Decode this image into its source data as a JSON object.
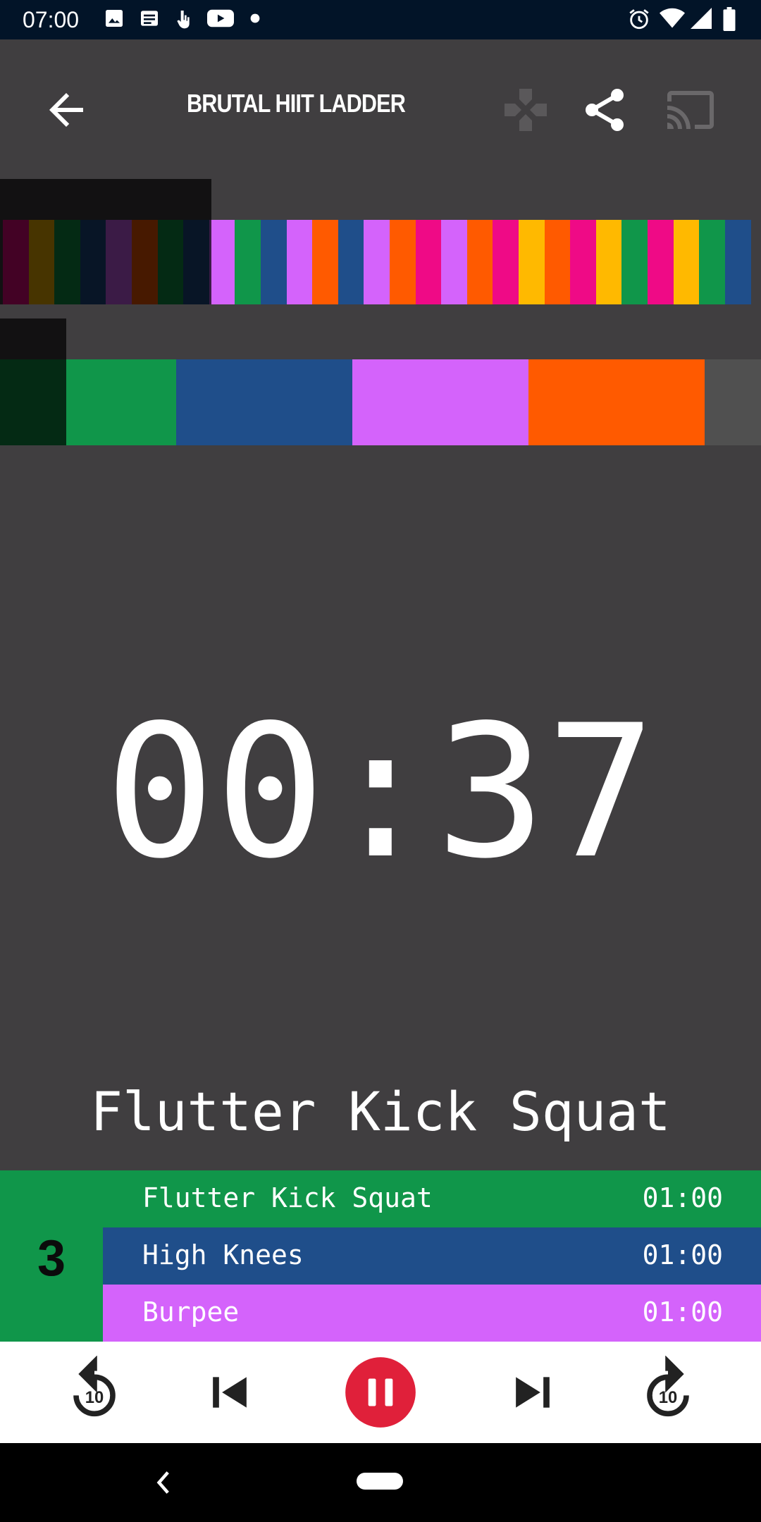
{
  "status_bar": {
    "time": "07:00",
    "left_icons": [
      "image-icon",
      "news-icon",
      "touch-icon",
      "youtube-icon",
      "dot-icon"
    ],
    "right_icons": [
      "alarm-icon",
      "wifi-icon",
      "signal-icon",
      "battery-icon"
    ]
  },
  "app_bar": {
    "title": "BRUTAL HIIT LADDER",
    "back_icon": "arrow-back-icon",
    "actions": [
      "gamepad-icon",
      "share-icon",
      "cast-icon"
    ]
  },
  "colors": {
    "background": "#403e40",
    "green": "#10964a",
    "blue": "#1f4e8a",
    "purple": "#d463fb",
    "orange": "#ff5a00",
    "pink": "#ef0a86",
    "yellow": "#ffb900",
    "gray": "#505050",
    "pause_red": "#e0203a"
  },
  "workout_strip": [
    "pink",
    "yellow",
    "green",
    "blue",
    "purple",
    "orange",
    "green",
    "blue",
    "purple",
    "green",
    "blue",
    "purple",
    "orange",
    "blue",
    "purple",
    "orange",
    "pink",
    "purple",
    "orange",
    "pink",
    "yellow",
    "orange",
    "pink",
    "yellow",
    "green",
    "pink",
    "yellow",
    "green",
    "blue"
  ],
  "round_strip": [
    "green",
    "green",
    "blue",
    "purple",
    "orange",
    "gray"
  ],
  "timer": "00:37",
  "current_exercise": "Flutter Kick Squat",
  "round": "3",
  "queue": [
    {
      "name": "Flutter Kick Squat",
      "time": "01:00",
      "color": "#10964a"
    },
    {
      "name": "High Knees",
      "time": "01:00",
      "color": "#1f4e8a"
    },
    {
      "name": "Burpee",
      "time": "01:00",
      "color": "#d463fb"
    }
  ],
  "controls": {
    "rewind_label": "10",
    "forward_label": "10",
    "icons": [
      "replay-10-icon",
      "skip-previous-icon",
      "pause-icon",
      "skip-next-icon",
      "forward-10-icon"
    ]
  }
}
